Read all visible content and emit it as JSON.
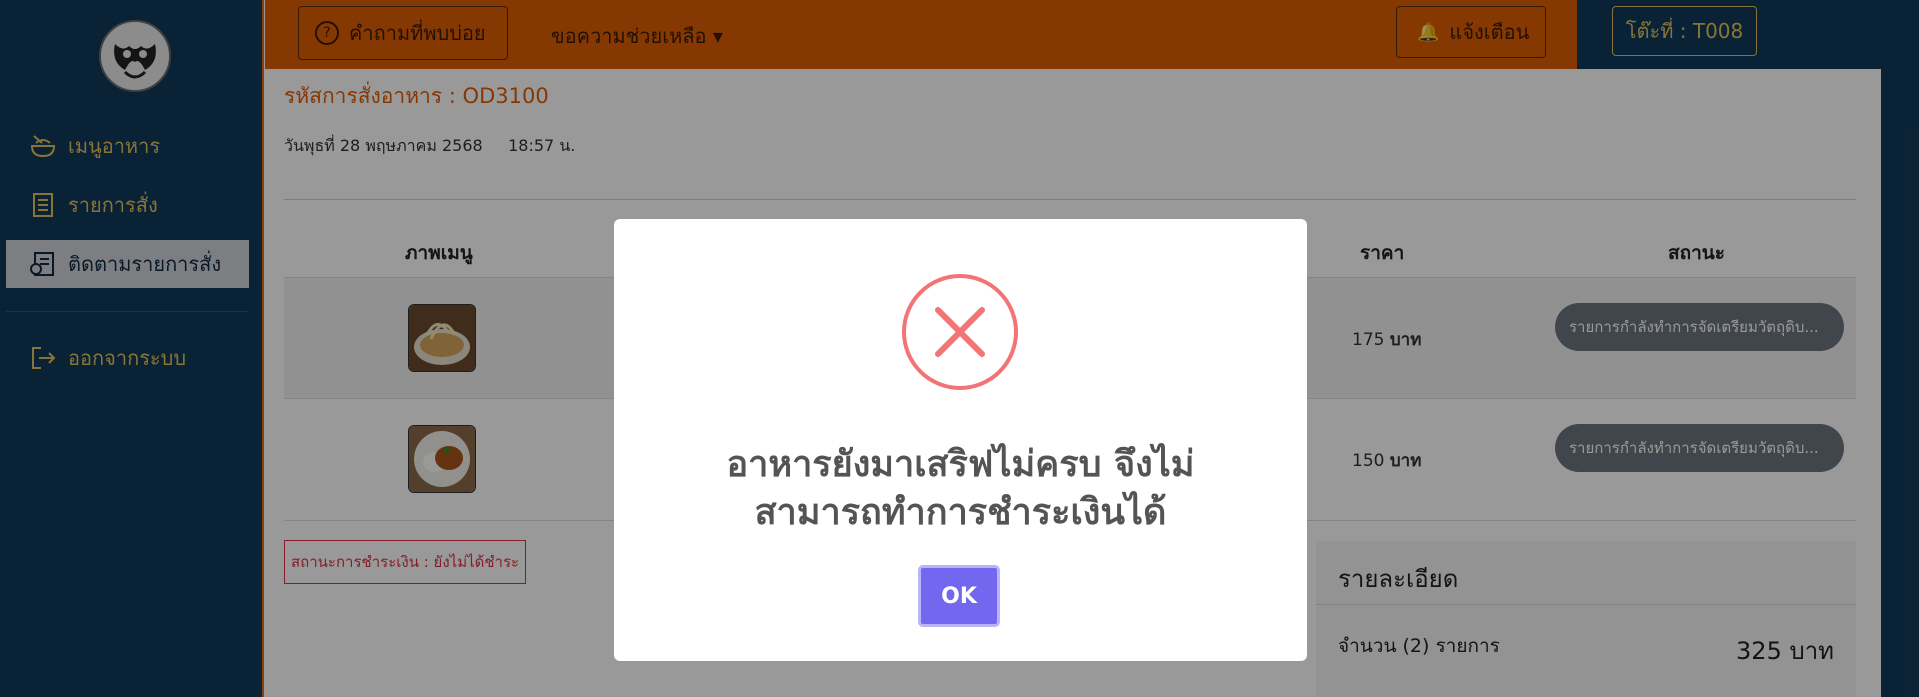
{
  "sidebar": {
    "items": [
      {
        "label": "เมนูอาหาร",
        "icon": "food-bowl-icon"
      },
      {
        "label": "รายการสั่ง",
        "icon": "order-list-icon"
      },
      {
        "label": "ติดตามรายการสั่ง",
        "icon": "track-order-icon"
      },
      {
        "label": "ออกจากระบบ",
        "icon": "logout-icon"
      }
    ]
  },
  "topbar": {
    "faq_label": "คำถามที่พบบ่อย",
    "help_label": "ขอความช่วยเหลือ",
    "notify_label": "แจ้งเตือน",
    "table_label": "โต๊ะที่ : T008",
    "accent": "#e05e06"
  },
  "order": {
    "code": "รหัสการสั่งอาหาร : OD3100",
    "date": "วันพุธที่ 28 พฤษภาคม 2568",
    "time": "18:57 น.",
    "headers": {
      "image": "ภาพเมนู",
      "price": "ราคา",
      "status": "สถานะ"
    },
    "rows": [
      {
        "price": "175",
        "unit": "บาท",
        "status": "รายการกำลังทำการจัดเตรียมวัตถุดิบ..."
      },
      {
        "price": "150",
        "unit": "บาท",
        "status": "รายการกำลังทำการจัดเตรียมวัตถุดิบ..."
      }
    ],
    "payment_status": "สถานะการชำระเงิน : ยังไม่ได้ชำระ",
    "detail": {
      "heading": "รายละเอียด",
      "qty": "จำนวน (2) รายการ",
      "total": "325 บาท"
    }
  },
  "modal": {
    "line1": "อาหารยังมาเสริฟไม่ครบ จึงไม่",
    "line2": "สามารถทำการชำระเงินได้",
    "ok_label": "OK",
    "error_color": "#f27474",
    "button_color": "#7367f0"
  }
}
